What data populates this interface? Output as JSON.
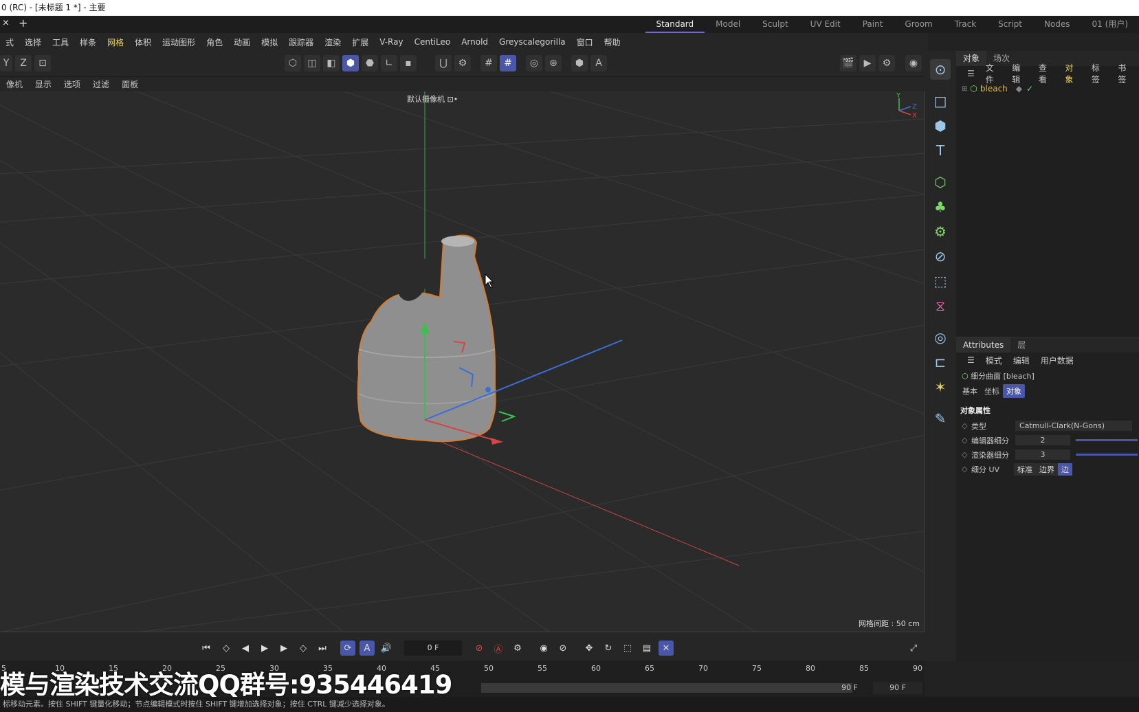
{
  "window_title": "0 (RC) - [未标题 1 *] - 主要",
  "tabs": {
    "close": "×",
    "add": "+"
  },
  "layouts": [
    "Standard",
    "Model",
    "Sculpt",
    "UV Edit",
    "Paint",
    "Groom",
    "Track",
    "Script",
    "Nodes",
    "01 (用户)"
  ],
  "active_layout": "Standard",
  "menus": [
    "式",
    "选择",
    "工具",
    "样条",
    "网格",
    "体积",
    "运动图形",
    "角色",
    "动画",
    "模拟",
    "跟踪器",
    "渲染",
    "扩展",
    "V-Ray",
    "CentiLeo",
    "Arnold",
    "Greyscalegorilla",
    "窗口",
    "帮助"
  ],
  "highlight_menu": "网格",
  "axis_buttons": {
    "y": "Y",
    "z": "Z"
  },
  "view_menus": [
    "像机",
    "显示",
    "选项",
    "过滤",
    "面板"
  ],
  "viewport": {
    "camera_label": "默认摄像机 ⊡•",
    "grid_spacing": "网格间距 : 50 cm",
    "axis_y": "Y",
    "axis_z": "Z",
    "axis_x": "X"
  },
  "object_panel": {
    "tabs": [
      "对象",
      "场次"
    ],
    "menus": [
      "文件",
      "编辑",
      "查看",
      "对象",
      "标签",
      "书签"
    ],
    "highlight_menu": "对象",
    "objects": [
      {
        "name": "bleach"
      }
    ]
  },
  "attributes": {
    "tabs": [
      "Attributes",
      "层"
    ],
    "menus": [
      "模式",
      "编辑",
      "用户数据"
    ],
    "object_title": "细分曲面 [bleach]",
    "subtabs": [
      "基本",
      "坐标",
      "对象"
    ],
    "active_subtab": "对象",
    "section": "对象属性",
    "props": [
      {
        "label": "类型",
        "value": "Catmull-Clark(N-Gons)"
      },
      {
        "label": "编辑器细分",
        "value": "2"
      },
      {
        "label": "渲染器细分",
        "value": "3"
      },
      {
        "label": "细分 UV",
        "options": [
          "标准",
          "边界",
          "边"
        ],
        "selected": "边"
      }
    ]
  },
  "timeline": {
    "current_frame": "0 F",
    "end_frame": "90 F",
    "end_frame_field": "90 F",
    "ruler_ticks": [
      "5",
      "10",
      "15",
      "20",
      "25",
      "30",
      "35",
      "40",
      "45",
      "50",
      "55",
      "60",
      "65",
      "70",
      "75",
      "80",
      "85",
      "90"
    ]
  },
  "watermark": "模与渲染技术交流QQ群号:935446419",
  "status_text": "标移动元素。按住 SHIFT 键量化移动；节点编辑模式时按住 SHIFT 键增加选择对象；按住 CTRL 键减少选择对象。",
  "colors": {
    "accent": "#4a57a8",
    "highlight": "#e8d36a",
    "selection_outline": "#c97a2e"
  }
}
